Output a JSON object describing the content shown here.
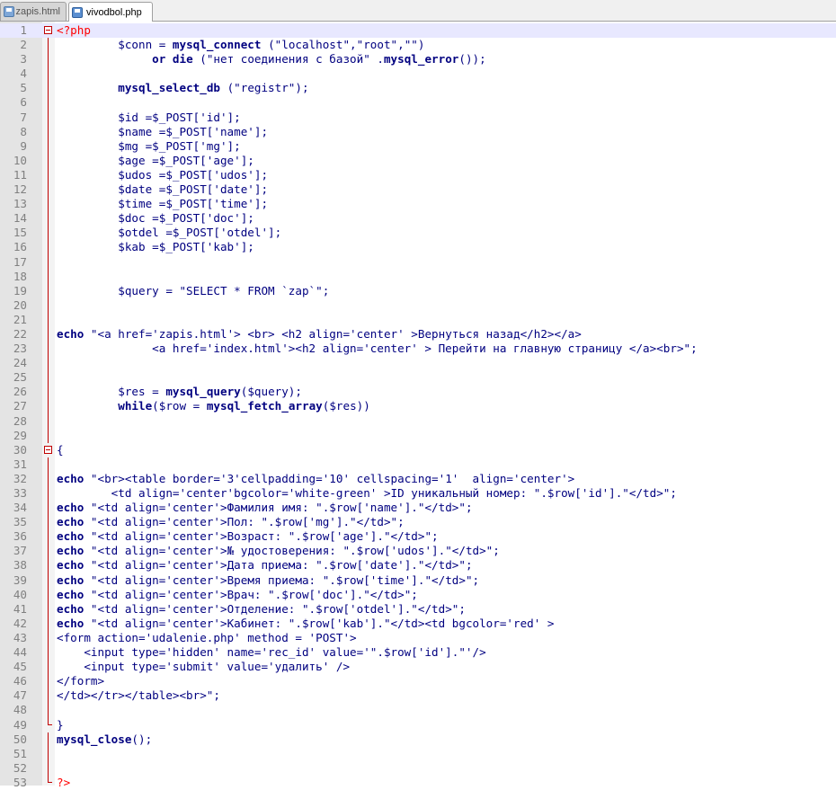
{
  "tabs": [
    {
      "label": "zapis.html",
      "active": false
    },
    {
      "label": "vivodbol.php",
      "active": true
    }
  ],
  "current_line": 1,
  "lines": [
    {
      "n": "1",
      "text": "<?php",
      "fold": "box"
    },
    {
      "n": "2",
      "text": "         $conn = mysql_connect (\"localhost\",\"root\",\"\")",
      "fold": "vline"
    },
    {
      "n": "3",
      "text": "              or die (\"нет соединения с базой\" .mysql_error());",
      "fold": "vline"
    },
    {
      "n": "4",
      "text": "",
      "fold": "vline"
    },
    {
      "n": "5",
      "text": "         mysql_select_db (\"registr\");",
      "fold": "vline"
    },
    {
      "n": "6",
      "text": "",
      "fold": "vline"
    },
    {
      "n": "7",
      "text": "         $id =$_POST['id'];",
      "fold": "vline"
    },
    {
      "n": "8",
      "text": "         $name =$_POST['name'];",
      "fold": "vline"
    },
    {
      "n": "9",
      "text": "         $mg =$_POST['mg'];",
      "fold": "vline"
    },
    {
      "n": "10",
      "text": "         $age =$_POST['age'];",
      "fold": "vline"
    },
    {
      "n": "11",
      "text": "         $udos =$_POST['udos'];",
      "fold": "vline"
    },
    {
      "n": "12",
      "text": "         $date =$_POST['date'];",
      "fold": "vline"
    },
    {
      "n": "13",
      "text": "         $time =$_POST['time'];",
      "fold": "vline"
    },
    {
      "n": "14",
      "text": "         $doc =$_POST['doc'];",
      "fold": "vline"
    },
    {
      "n": "15",
      "text": "         $otdel =$_POST['otdel'];",
      "fold": "vline"
    },
    {
      "n": "16",
      "text": "         $kab =$_POST['kab'];",
      "fold": "vline"
    },
    {
      "n": "17",
      "text": "",
      "fold": "vline"
    },
    {
      "n": "18",
      "text": "",
      "fold": "vline"
    },
    {
      "n": "19",
      "text": "         $query = \"SELECT * FROM `zap`\";",
      "fold": "vline"
    },
    {
      "n": "20",
      "text": "",
      "fold": "vline"
    },
    {
      "n": "21",
      "text": "",
      "fold": "vline"
    },
    {
      "n": "22",
      "text": "echo \"<a href='zapis.html'> <br> <h2 align='center' >Вернуться назад</h2></a>",
      "fold": "vline"
    },
    {
      "n": "23",
      "text": "              <a href='index.html'><h2 align='center' > Перейти на главную страницу </a><br>\";",
      "fold": "vline"
    },
    {
      "n": "24",
      "text": "",
      "fold": "vline"
    },
    {
      "n": "25",
      "text": "",
      "fold": "vline"
    },
    {
      "n": "26",
      "text": "         $res = mysql_query($query);",
      "fold": "vline"
    },
    {
      "n": "27",
      "text": "         while($row = mysql_fetch_array($res))",
      "fold": "vline"
    },
    {
      "n": "28",
      "text": "",
      "fold": "vline"
    },
    {
      "n": "29",
      "text": "",
      "fold": "vline"
    },
    {
      "n": "30",
      "text": "{",
      "fold": "box"
    },
    {
      "n": "31",
      "text": "",
      "fold": "vline"
    },
    {
      "n": "32",
      "text": "echo \"<br><table border='3'cellpadding='10' cellspacing='1'  align='center'>",
      "fold": "vline"
    },
    {
      "n": "33",
      "text": "        <td align='center'bgcolor='white-green' >ID уникальный номер: \".$row['id'].\"</td>\";",
      "fold": "vline"
    },
    {
      "n": "34",
      "text": "echo \"<td align='center'>Фамилия имя: \".$row['name'].\"</td>\";",
      "fold": "vline"
    },
    {
      "n": "35",
      "text": "echo \"<td align='center'>Пол: \".$row['mg'].\"</td>\";",
      "fold": "vline"
    },
    {
      "n": "36",
      "text": "echo \"<td align='center'>Возраст: \".$row['age'].\"</td>\";",
      "fold": "vline"
    },
    {
      "n": "37",
      "text": "echo \"<td align='center'>№ удостоверения: \".$row['udos'].\"</td>\";",
      "fold": "vline"
    },
    {
      "n": "38",
      "text": "echo \"<td align='center'>Дата приема: \".$row['date'].\"</td>\";",
      "fold": "vline"
    },
    {
      "n": "39",
      "text": "echo \"<td align='center'>Время приема: \".$row['time'].\"</td>\";",
      "fold": "vline"
    },
    {
      "n": "40",
      "text": "echo \"<td align='center'>Врач: \".$row['doc'].\"</td>\";",
      "fold": "vline"
    },
    {
      "n": "41",
      "text": "echo \"<td align='center'>Отделение: \".$row['otdel'].\"</td>\";",
      "fold": "vline"
    },
    {
      "n": "42",
      "text": "echo \"<td align='center'>Кабинет: \".$row['kab'].\"</td><td bgcolor='red' >",
      "fold": "vline"
    },
    {
      "n": "43",
      "text": "<form action='udalenie.php' method = 'POST'>",
      "fold": "vline"
    },
    {
      "n": "44",
      "text": "    <input type='hidden' name='rec_id' value='\".$row['id'].\"'/>",
      "fold": "vline"
    },
    {
      "n": "45",
      "text": "    <input type='submit' value='удалить' />",
      "fold": "vline"
    },
    {
      "n": "46",
      "text": "</form>",
      "fold": "vline"
    },
    {
      "n": "47",
      "text": "</td></tr></table><br>\";",
      "fold": "vline"
    },
    {
      "n": "48",
      "text": "",
      "fold": "vline"
    },
    {
      "n": "49",
      "text": "}",
      "fold": "end"
    },
    {
      "n": "50",
      "text": "mysql_close();",
      "fold": "vline"
    },
    {
      "n": "51",
      "text": "",
      "fold": "vline"
    },
    {
      "n": "52",
      "text": "",
      "fold": "vline"
    },
    {
      "n": "53",
      "text": "?>",
      "fold": "end"
    }
  ],
  "colors": {
    "keyword": "#000080",
    "php_tag": "#ff0000",
    "current_line_bg": "#e8e8ff",
    "fold_marker": "#c00000"
  }
}
